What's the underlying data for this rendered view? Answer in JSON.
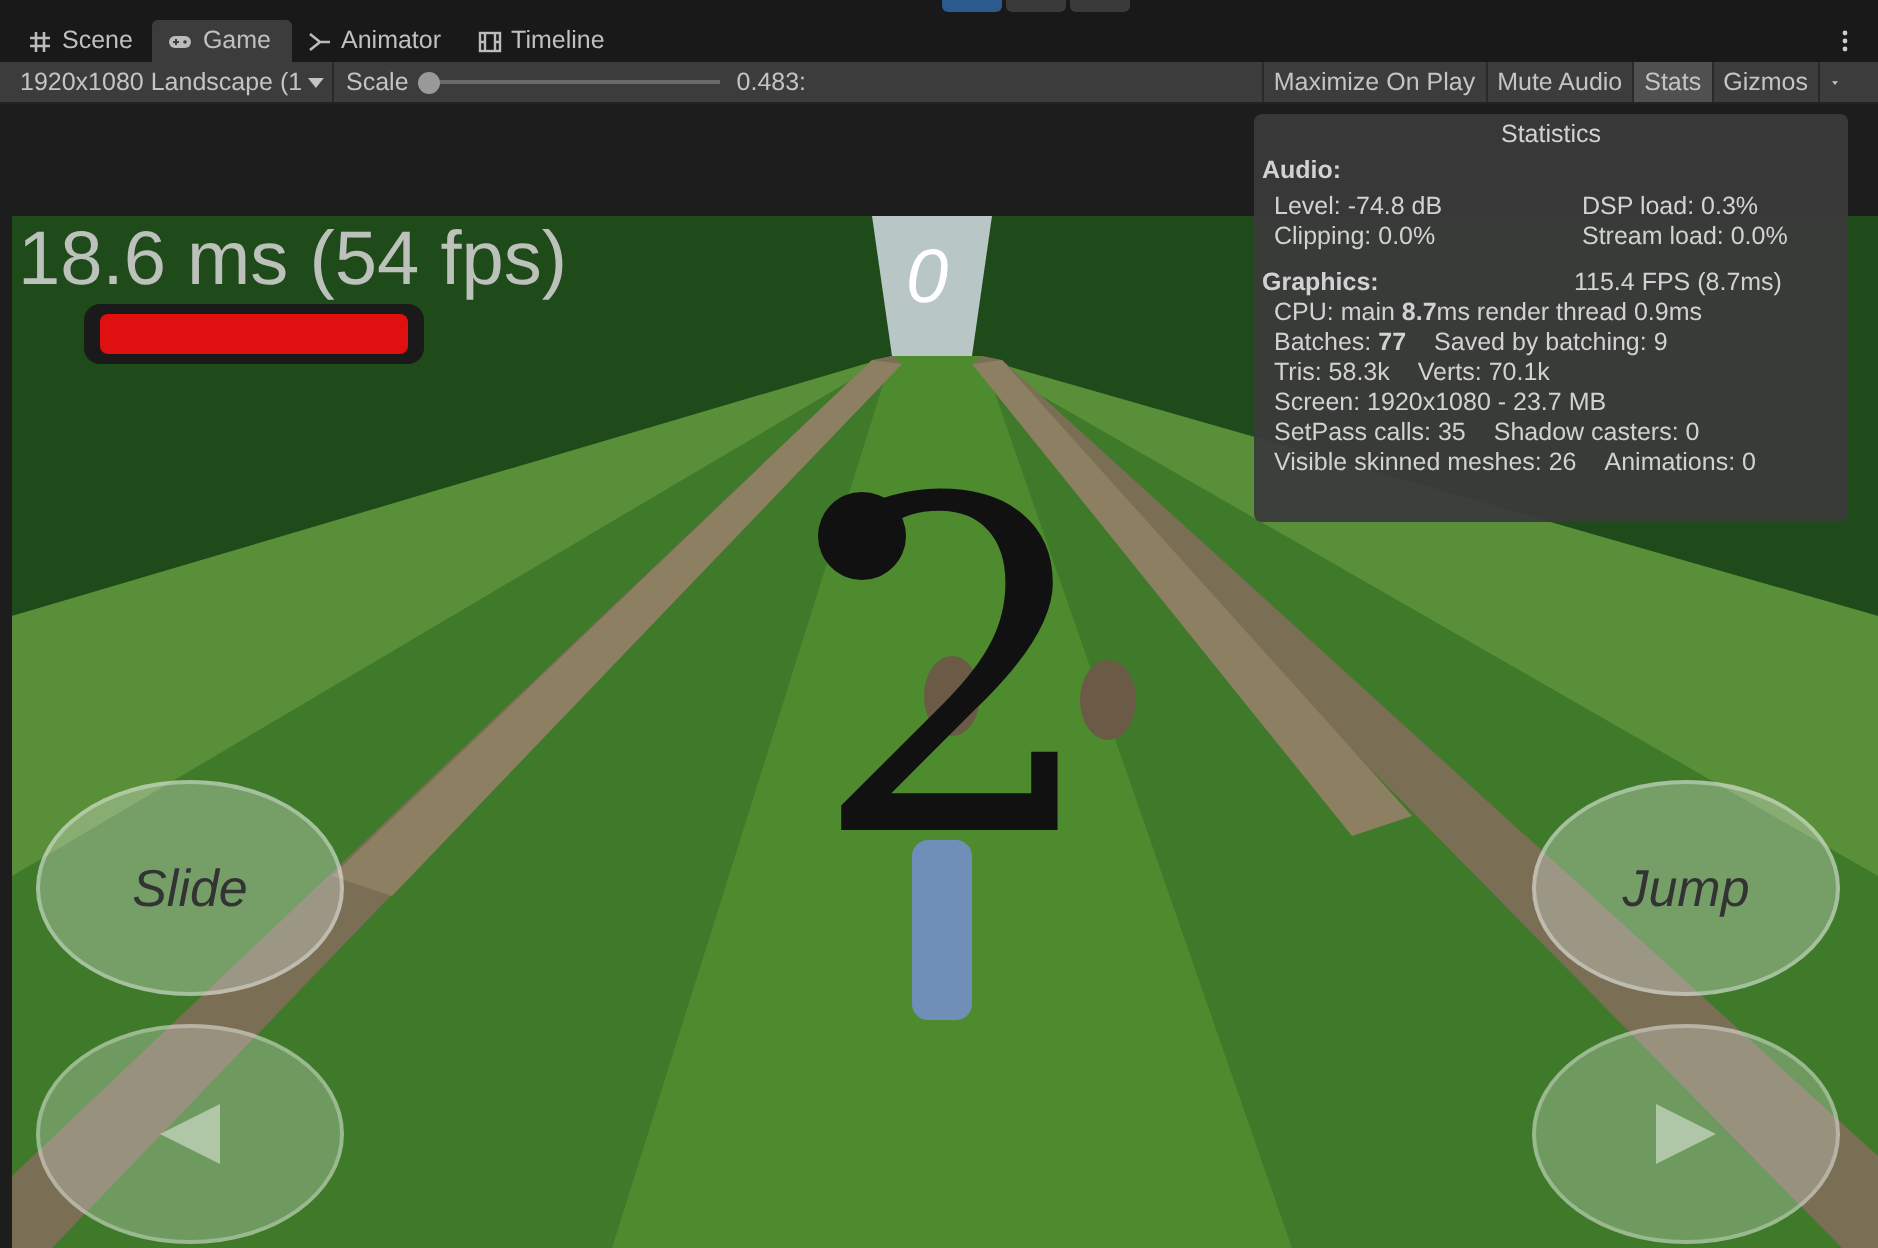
{
  "play_controls": [
    {
      "selected": true
    },
    {
      "selected": false
    },
    {
      "selected": false
    }
  ],
  "tabs": [
    {
      "label": "Scene",
      "selected": false
    },
    {
      "label": "Game",
      "selected": true
    },
    {
      "label": "Animator",
      "selected": false
    },
    {
      "label": "Timeline",
      "selected": false
    }
  ],
  "toolbar": {
    "resolution": "1920x1080 Landscape (1",
    "scale_label": "Scale",
    "scale": {
      "level": 0.02
    },
    "scale_value": "0.483:",
    "toggles": [
      {
        "label": "Maximize On Play",
        "on": false
      },
      {
        "label": "Mute Audio",
        "on": false
      },
      {
        "label": "Stats",
        "on": true
      },
      {
        "label": "Gizmos",
        "on": false
      }
    ]
  },
  "game_hud": {
    "frame_time": "18.6 ms (54 fps)",
    "health": {
      "level": 1
    },
    "score": "0",
    "countdown": "2",
    "buttons": [
      {
        "label": "Slide"
      },
      {
        "label": "Jump"
      }
    ]
  },
  "statistics": {
    "title": "Statistics",
    "sections": [
      {
        "heading": "Audio:",
        "lines": [
          [
            "Level: -74.8 dB",
            "DSP load: 0.3%"
          ],
          [
            "Clipping: 0.0%",
            "Stream load: 0.0%"
          ]
        ]
      },
      {
        "heading": "Graphics:",
        "heading_right": "115.4 FPS (8.7ms)",
        "lines": [
          [
            "CPU: main **8.7**ms  render thread 0.9ms"
          ],
          [
            "Batches: **77**",
            "Saved by batching: 9"
          ],
          [
            "Tris: 58.3k",
            "Verts: 70.1k"
          ],
          [
            "Screen: 1920x1080 - 23.7 MB"
          ],
          [
            "SetPass calls: 35",
            "Shadow casters: 0"
          ],
          [
            "Visible skinned meshes: 26",
            "Animations: 0"
          ]
        ]
      }
    ]
  }
}
